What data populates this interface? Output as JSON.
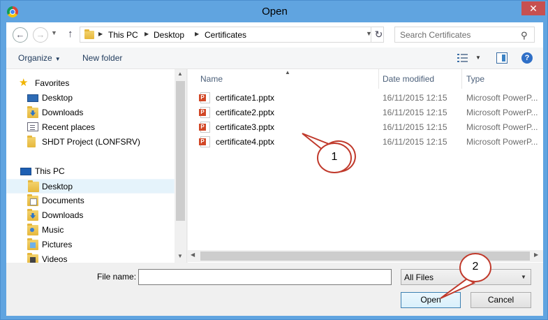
{
  "window": {
    "title": "Open",
    "close_glyph": "✕",
    "app_icon": "chrome-icon"
  },
  "address": {
    "crumbs": [
      "This PC",
      "Desktop",
      "Certificates"
    ],
    "search_placeholder": "Search Certificates"
  },
  "toolbar": {
    "organize_label": "Organize",
    "new_folder_label": "New folder"
  },
  "nav_pane": {
    "favorites_label": "Favorites",
    "favorites": [
      {
        "label": "Desktop",
        "icon": "desktop-icon"
      },
      {
        "label": "Downloads",
        "icon": "downloads-icon"
      },
      {
        "label": "Recent places",
        "icon": "recent-places-icon"
      },
      {
        "label": "SHDT Project (LONFSRV)",
        "icon": "network-folder-icon"
      }
    ],
    "thispc_label": "This PC",
    "thispc": [
      {
        "label": "Desktop",
        "icon": "folder-icon",
        "selected": true
      },
      {
        "label": "Documents",
        "icon": "documents-icon"
      },
      {
        "label": "Downloads",
        "icon": "downloads-icon"
      },
      {
        "label": "Music",
        "icon": "music-icon"
      },
      {
        "label": "Pictures",
        "icon": "pictures-icon"
      },
      {
        "label": "Videos",
        "icon": "videos-icon"
      }
    ]
  },
  "file_list": {
    "columns": {
      "name": "Name",
      "date": "Date modified",
      "type": "Type"
    },
    "files": [
      {
        "name": "certificate1.pptx",
        "date": "16/11/2015 12:15",
        "type": "Microsoft PowerP..."
      },
      {
        "name": "certificate2.pptx",
        "date": "16/11/2015 12:15",
        "type": "Microsoft PowerP..."
      },
      {
        "name": "certificate3.pptx",
        "date": "16/11/2015 12:15",
        "type": "Microsoft PowerP..."
      },
      {
        "name": "certificate4.pptx",
        "date": "16/11/2015 12:15",
        "type": "Microsoft PowerP..."
      }
    ]
  },
  "bottom": {
    "file_name_label": "File name:",
    "file_name_value": "",
    "filter_value": "All Files",
    "open_label": "Open",
    "cancel_label": "Cancel"
  },
  "callouts": {
    "one": "1",
    "two": "2"
  }
}
